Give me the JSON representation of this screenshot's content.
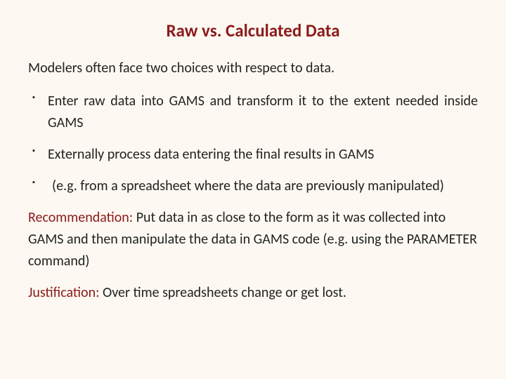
{
  "title": "Raw vs. Calculated Data",
  "intro": "Modelers often face two choices with respect to data.",
  "bullets": {
    "b1": "Enter raw data into GAMS and transform it to the extent needed inside GAMS",
    "b2": "Externally process data entering the final results in GAMS",
    "b3": "(e.g. from a spreadsheet where the data are previously manipulated)"
  },
  "recommendation": {
    "label": "Recommendation:",
    "text": " Put data in as close to the form as it was collected into GAMS and then manipulate the data in GAMS code (e.g. using the PARAMETER command)"
  },
  "justification": {
    "label": "Justification:",
    "text": " Over time spreadsheets change or get lost."
  }
}
